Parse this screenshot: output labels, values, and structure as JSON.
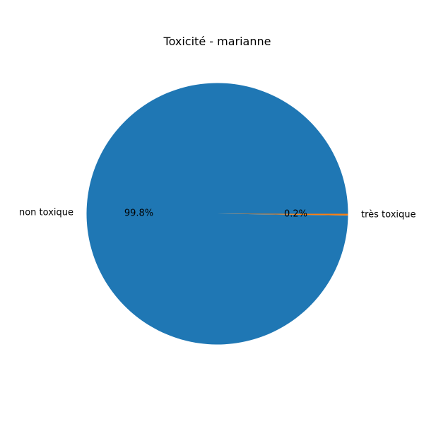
{
  "chart_data": {
    "type": "pie",
    "title": "Toxicité - marianne",
    "slices": [
      {
        "label": "non toxique",
        "value": 99.8,
        "pct_label": "99.8%",
        "color": "#1f77b4"
      },
      {
        "label": "très toxique",
        "value": 0.2,
        "pct_label": "0.2%",
        "color": "#ff7f0e"
      }
    ],
    "start_angle_deg": 0,
    "direction": "counterclockwise",
    "legend": "none"
  }
}
